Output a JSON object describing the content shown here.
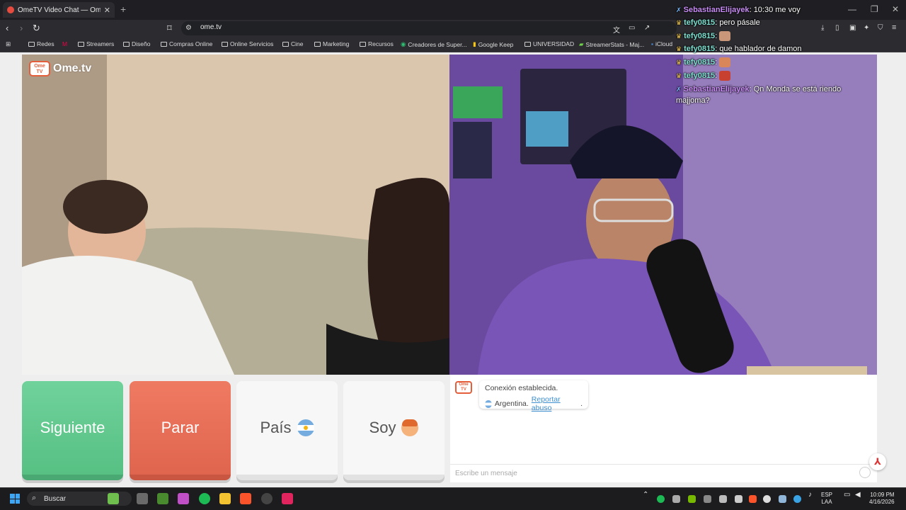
{
  "browser": {
    "tab_title": "OmeTV Video Chat — Omeg",
    "tab_close": "✕",
    "new_tab": "+",
    "url": "ome.tv",
    "bookmarks": [
      "Redes",
      "Streamers",
      "Diseño",
      "Compras Online",
      "Online Servicios",
      "Cine",
      "Marketing",
      "Recursos",
      "Creadores de Super...",
      "Google Keep",
      "UNIVERSIDAD",
      "StreamerStats - Maj...",
      "iCloud"
    ]
  },
  "page": {
    "logo_text": "Ome.tv",
    "logo_badge": "Ome TV",
    "buttons": {
      "next": "Siguiente",
      "stop": "Parar",
      "country": "País",
      "me": "Soy"
    },
    "chat": {
      "status": "Conexión establecida.",
      "country": "Argentina.",
      "report": "Reportar abuso",
      "report_suffix": ".",
      "placeholder": "Escribe un mensaje"
    }
  },
  "stream_chat": [
    {
      "user": "SebastianElijayek",
      "text": "10:30 me voy",
      "badge": "sword-icon"
    },
    {
      "user": "tefy0815",
      "text": "pero pásale",
      "badge": "crown-icon"
    },
    {
      "user": "tefy0815",
      "text": "",
      "badge": "crown-icon",
      "emote": true
    },
    {
      "user": "tefy0815",
      "text": "que hablador de damon",
      "badge": "crown-icon"
    },
    {
      "user": "tefy0815",
      "text": "",
      "badge": "crown-icon",
      "emote": true
    },
    {
      "user": "tefy0815",
      "text": "",
      "badge": "crown-icon",
      "emote": true
    },
    {
      "user": "SebastianElijayek",
      "text": "Qn Monda se está riendo",
      "text2": "majjoma?",
      "badge": "sword-icon"
    }
  ],
  "taskbar": {
    "search": "Buscar",
    "lang": "ESP",
    "lang2": "LAA",
    "time": "10:09 PM",
    "date": "4/16/2026"
  },
  "colors": {
    "next": "#5cc68a",
    "stop": "#e56b53",
    "accent": "#e45e3c",
    "link": "#3e8fd0"
  }
}
